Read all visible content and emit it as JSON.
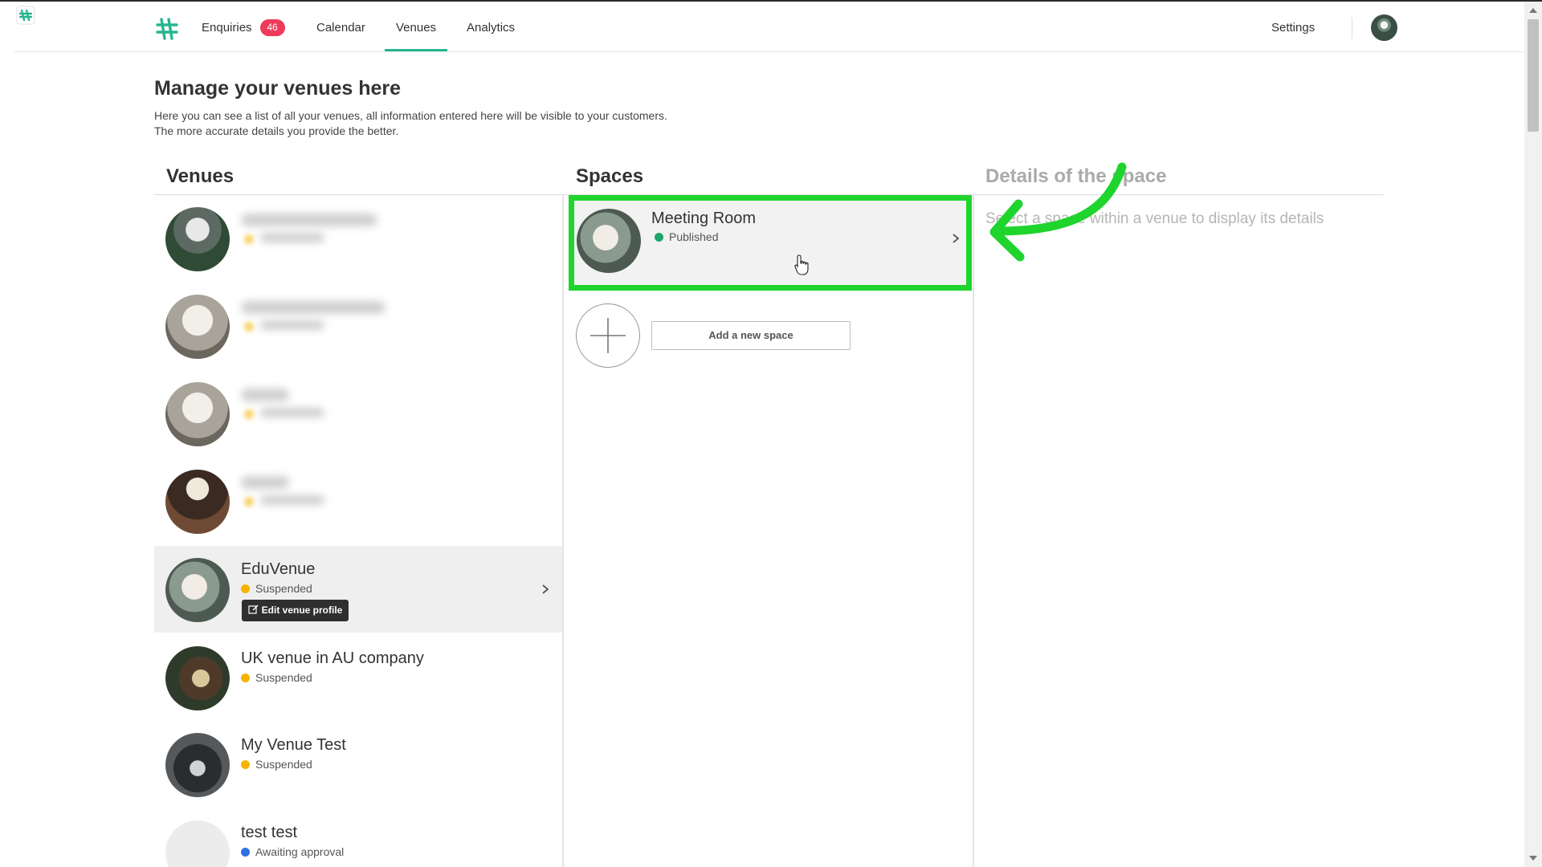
{
  "nav": {
    "items": [
      {
        "label": "Enquiries",
        "badge": "46"
      },
      {
        "label": "Calendar"
      },
      {
        "label": "Venues"
      },
      {
        "label": "Analytics"
      }
    ],
    "settings_label": "Settings"
  },
  "header": {
    "title": "Manage your venues here",
    "desc_line1": "Here you can see a list of all your venues, all information entered here will be visible to your customers.",
    "desc_line2": "The more accurate details you provide the better."
  },
  "columns": {
    "venues_title": "Venues",
    "spaces_title": "Spaces",
    "details_title": "Details of the space"
  },
  "venues": [
    {
      "name": "EduVenue",
      "status": "Suspended",
      "status_color": "#f5b400",
      "edit_label": "Edit venue profile"
    },
    {
      "name": "UK venue in AU company",
      "status": "Suspended",
      "status_color": "#f5b400"
    },
    {
      "name": "My Venue Test",
      "status": "Suspended",
      "status_color": "#f5b400"
    },
    {
      "name": "test test",
      "status": "Awaiting approval",
      "status_color": "#2f6fe4"
    }
  ],
  "spaces": [
    {
      "name": "Meeting Room",
      "status": "Published",
      "status_color": "#1fa66b"
    }
  ],
  "add_space_label": "Add a new space",
  "details_placeholder": "Select a space within a venue to display its details",
  "colors": {
    "accent": "#25b68f",
    "badge": "#ef3b5a",
    "highlight": "#1fd42d"
  }
}
